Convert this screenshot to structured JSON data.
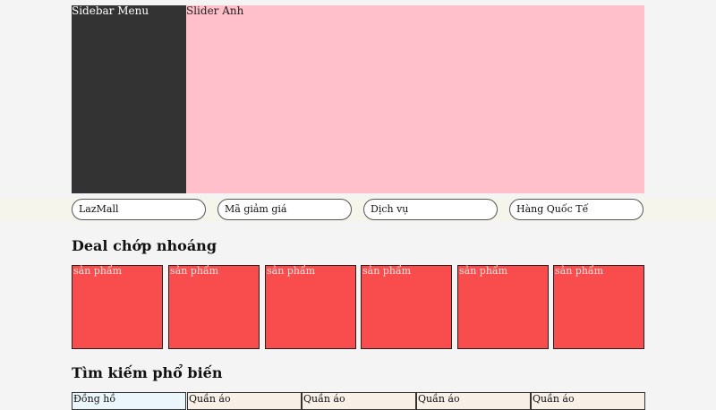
{
  "sidebar": {
    "label": "Sidebar Menu"
  },
  "slider": {
    "label": "Slider Anh"
  },
  "quick_links": [
    {
      "label": "LazMall"
    },
    {
      "label": "Mã giảm giá"
    },
    {
      "label": "Dịch vụ"
    },
    {
      "label": "Hàng Quốc Tế"
    }
  ],
  "deal_section": {
    "title": "Deal chớp nhoáng",
    "products": [
      {
        "label": "sản phẩm"
      },
      {
        "label": "sản phẩm"
      },
      {
        "label": "sản phẩm"
      },
      {
        "label": "sản phẩm"
      },
      {
        "label": "sản phẩm"
      },
      {
        "label": "sản phẩm"
      }
    ]
  },
  "popular_section": {
    "title": "Tìm kiếm phổ biến",
    "items": [
      {
        "label": "Đồng hồ"
      },
      {
        "label": "Quần áo"
      },
      {
        "label": "Quần áo"
      },
      {
        "label": "Quần áo"
      },
      {
        "label": "Quần áo"
      }
    ]
  },
  "colors": {
    "sidebar_bg": "#333333",
    "slider_bg": "#ffc0cb",
    "product_bg": "#f94d4d",
    "page_bg": "#f4f4f4",
    "search_first_bg": "#eaf6fb",
    "search_other_bg": "#f8efe6"
  }
}
